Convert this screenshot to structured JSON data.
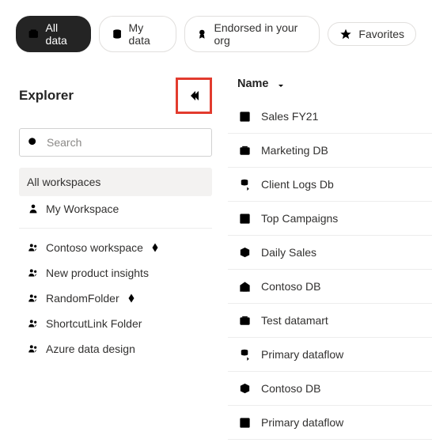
{
  "filters": {
    "all_data": "All data",
    "my_data": "My data",
    "endorsed": "Endorsed in your org",
    "favorites": "Favorites"
  },
  "explorer": {
    "title": "Explorer",
    "search_placeholder": "Search",
    "all_workspaces": "All workspaces",
    "workspaces": [
      {
        "label": "My Workspace",
        "icon": "person",
        "premium": false
      },
      {
        "label": "Contoso workspace",
        "icon": "group",
        "premium": true
      },
      {
        "label": "New product insights",
        "icon": "group",
        "premium": false
      },
      {
        "label": "RandomFolder",
        "icon": "group",
        "premium": true
      },
      {
        "label": "ShortcutLink Folder",
        "icon": "group",
        "premium": false
      },
      {
        "label": "Azure data design",
        "icon": "group",
        "premium": false
      }
    ]
  },
  "table": {
    "header_name": "Name",
    "rows": [
      {
        "label": "Sales FY21",
        "icon": "dashboard"
      },
      {
        "label": "Marketing DB",
        "icon": "datamart"
      },
      {
        "label": "Client Logs Db",
        "icon": "dataflow"
      },
      {
        "label": "Top Campaigns",
        "icon": "dashboard"
      },
      {
        "label": "Daily Sales",
        "icon": "dataset"
      },
      {
        "label": "Contoso DB",
        "icon": "warehouse"
      },
      {
        "label": "Test datamart",
        "icon": "datamart"
      },
      {
        "label": "Primary dataflow",
        "icon": "dataflow"
      },
      {
        "label": "Contoso DB",
        "icon": "dataset"
      },
      {
        "label": "Primary dataflow",
        "icon": "dataflow-box"
      }
    ]
  }
}
